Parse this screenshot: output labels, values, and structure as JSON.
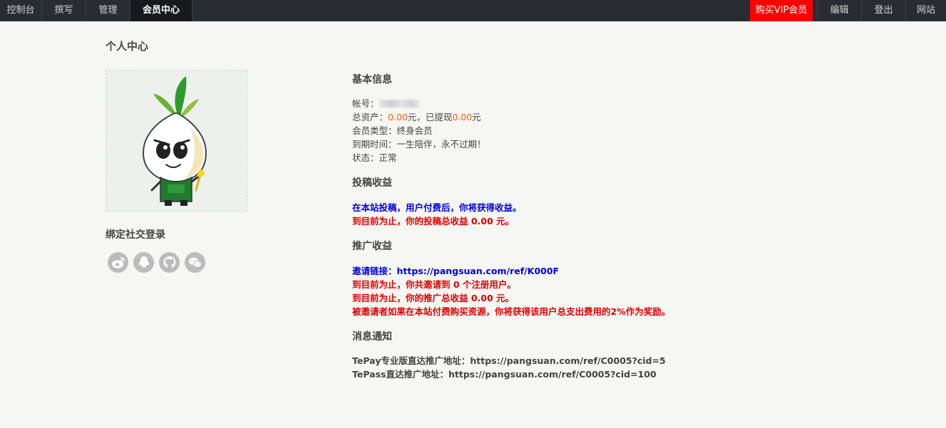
{
  "nav": {
    "left": [
      "控制台",
      "撰写",
      "管理",
      "会员中心"
    ],
    "right": [
      "购买VIP会员",
      "编辑",
      "登出",
      "网站"
    ]
  },
  "page_title": "个人中心",
  "social": {
    "title": "绑定社交登录",
    "icons": [
      "weibo-icon",
      "qq-icon",
      "github-icon",
      "wechat-icon"
    ]
  },
  "basic": {
    "title": "基本信息",
    "account_label": "帐号：",
    "assets_label": "总资产：",
    "assets_value": "0.00",
    "assets_unit": "元，已提现",
    "withdrawn_value": "0.00",
    "withdrawn_unit": "元",
    "member_type": "会员类型：终身会员",
    "expire": "到期时间：一生陪伴，永不过期！",
    "status": "状态：正常"
  },
  "contribution": {
    "title": "投稿收益",
    "line1": "在本站投稿，用户付费后，你将获得收益。",
    "line2": "到目前为止，你的投稿总收益 0.00 元。"
  },
  "promotion": {
    "title": "推广收益",
    "invite": "邀请链接：https://pangsuan.com/ref/K000F",
    "registered": "到目前为止，你共邀请到 0 个注册用户。",
    "total": "到目前为止，你的推广总收益 0.00 元。",
    "reward": "被邀请者如果在本站付费购买资源，你将获得该用户总支出费用的2%作为奖励。"
  },
  "notice": {
    "title": "消息通知",
    "line1": "TePay专业版直达推广地址：https://pangsuan.com/ref/C0005?cid=5",
    "line2": "TePass直达推广地址：https://pangsuan.com/ref/C0005?cid=100"
  },
  "colors": {
    "topbar": "#292d33",
    "vip": "#ff0000",
    "blue_text": "#0000e8",
    "red_text": "#e00000",
    "amount": "#ff5e00"
  }
}
